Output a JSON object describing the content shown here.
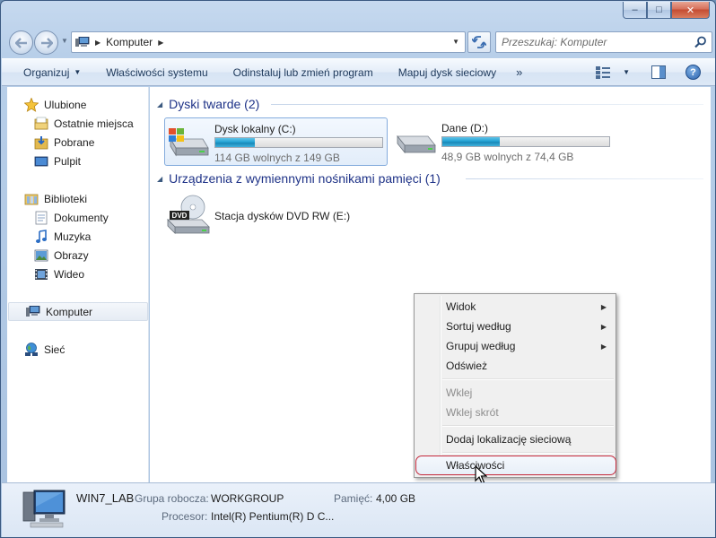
{
  "window": {
    "caption_buttons": {
      "minimize": "–",
      "maximize": "□",
      "close": "✕"
    }
  },
  "nav": {
    "back_icon": "back-arrow-icon",
    "forward_icon": "forward-arrow-icon",
    "address": {
      "path": "Komputer"
    },
    "search": {
      "placeholder": "Przeszukaj: Komputer"
    }
  },
  "toolbar": {
    "organize": "Organizuj",
    "system_properties": "Właściwości systemu",
    "uninstall": "Odinstaluj lub zmień program",
    "map_drive": "Mapuj dysk sieciowy",
    "more": "»",
    "help": "?"
  },
  "sidebar": {
    "favorites": {
      "label": "Ulubione",
      "items": [
        {
          "label": "Ostatnie miejsca"
        },
        {
          "label": "Pobrane"
        },
        {
          "label": "Pulpit"
        }
      ]
    },
    "libraries": {
      "label": "Biblioteki",
      "items": [
        {
          "label": "Dokumenty"
        },
        {
          "label": "Muzyka"
        },
        {
          "label": "Obrazy"
        },
        {
          "label": "Wideo"
        }
      ]
    },
    "computer": {
      "label": "Komputer"
    },
    "network": {
      "label": "Sieć"
    }
  },
  "content": {
    "hard_drives": {
      "header": "Dyski twarde (2)",
      "drives": [
        {
          "name": "Dysk lokalny (C:)",
          "free_text": "114 GB wolnych z 149 GB",
          "used_fraction": 0.235
        },
        {
          "name": "Dane (D:)",
          "free_text": "48,9 GB wolnych z 74,4 GB",
          "used_fraction": 0.343
        }
      ]
    },
    "removable": {
      "header": "Urządzenia z wymiennymi nośnikami pamięci (1)",
      "devices": [
        {
          "name": "Stacja dysków DVD RW (E:)",
          "badge": "DVD"
        }
      ]
    }
  },
  "context_menu": {
    "items": [
      {
        "label": "Widok",
        "submenu": "▶"
      },
      {
        "label": "Sortuj według",
        "submenu": "▶"
      },
      {
        "label": "Grupuj według",
        "submenu": "▶"
      },
      {
        "label": "Odśwież"
      },
      {
        "label": "Wklej"
      },
      {
        "label": "Wklej skrót"
      },
      {
        "label": "Dodaj lokalizację sieciową"
      },
      {
        "label": "Właściwości"
      }
    ]
  },
  "details": {
    "computer_name": "WIN7_LAB",
    "workgroup_label": "Grupa robocza:",
    "workgroup_value": "WORKGROUP",
    "memory_label": "Pamięć:",
    "memory_value": "4,00 GB",
    "processor_label": "Procesor:",
    "processor_value": "Intel(R) Pentium(R) D C..."
  },
  "colors": {
    "accent_header": "#1e3287",
    "progress_fill": "#23a3d4",
    "highlight_border": "#c4283a"
  }
}
